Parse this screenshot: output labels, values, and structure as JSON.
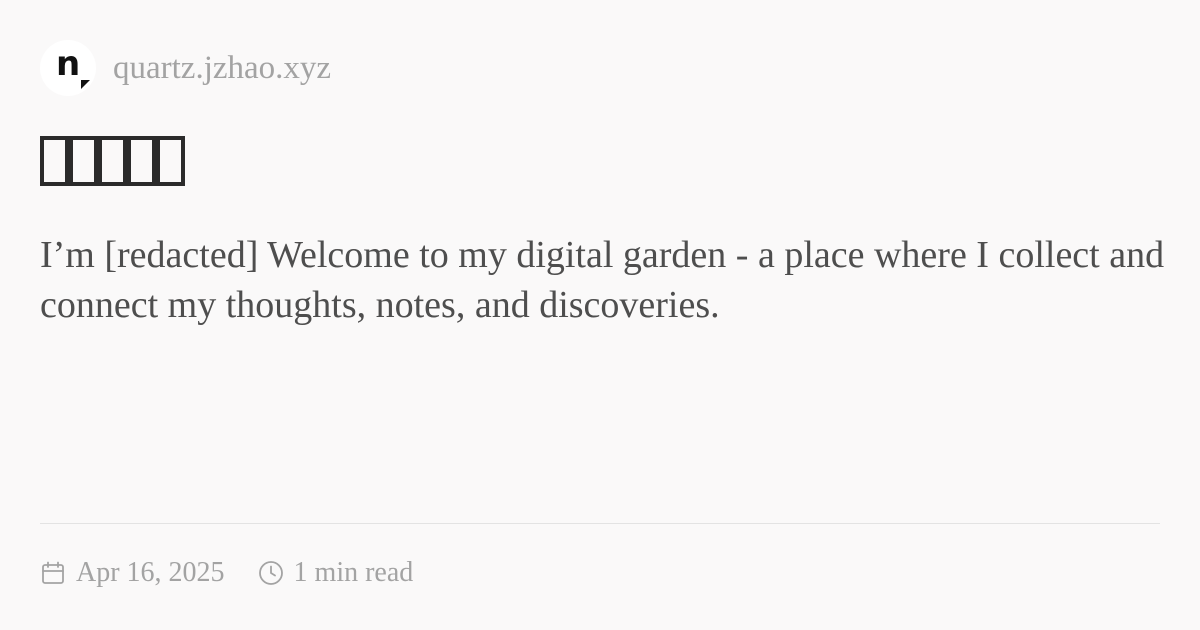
{
  "site": {
    "logo_letter": "n",
    "domain": "quartz.jzhao.xyz"
  },
  "page": {
    "title": "□□□□□",
    "description": "I’m [redacted] Welcome to my digital garden - a place where I collect and connect my thoughts, notes, and discoveries."
  },
  "meta": {
    "date": "Apr 16, 2025",
    "reading_time": "1 min read",
    "date_icon": "calendar-icon",
    "reading_icon": "clock-icon"
  },
  "colors": {
    "background": "#faf9f9",
    "title": "#2b2b2b",
    "body_text": "#4e4e4e",
    "muted_text": "#a3a3a3"
  }
}
